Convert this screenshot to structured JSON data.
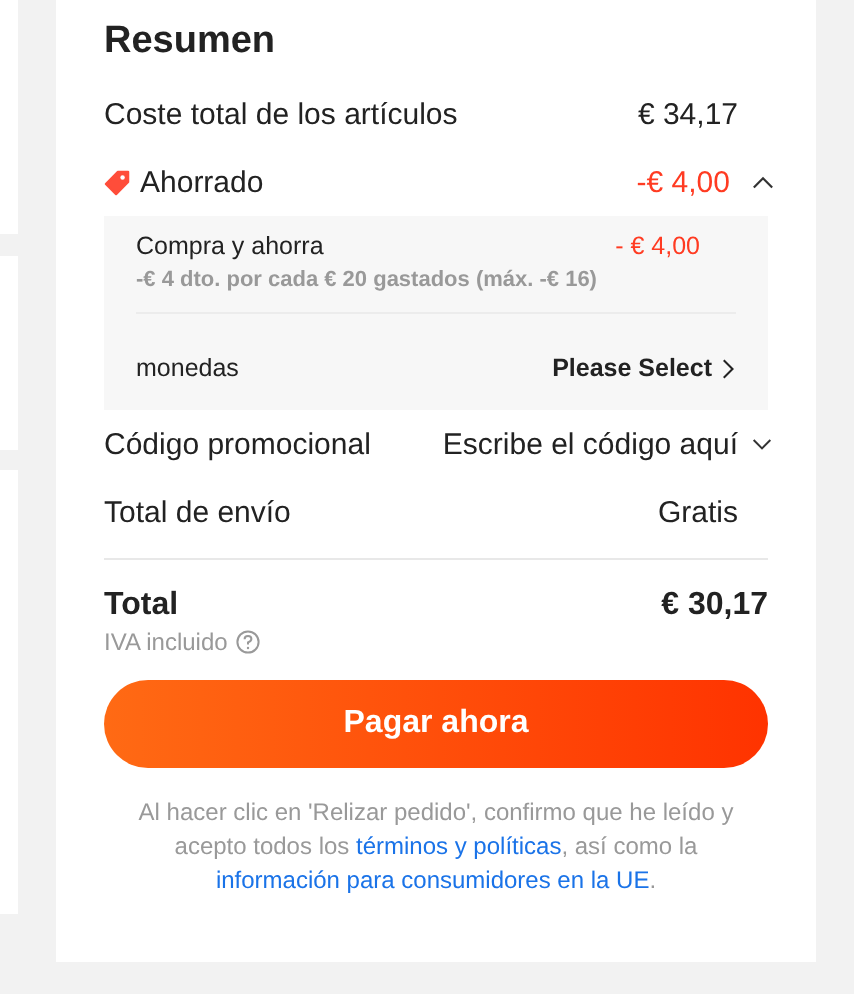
{
  "summary": {
    "title": "Resumen",
    "items_cost": {
      "label": "Coste total de los artículos",
      "value": "€ 34,17"
    },
    "savings": {
      "label": "Ahorrado",
      "value": "-€ 4,00",
      "expanded": true,
      "details": [
        {
          "kind": "discount",
          "label": "Compra y ahorra",
          "value": "- € 4,00",
          "note": "-€ 4 dto. por cada € 20 gastados (máx. -€ 16)"
        },
        {
          "kind": "select",
          "label": "monedas",
          "value": "Please Select"
        }
      ]
    },
    "promo": {
      "label": "Código promocional",
      "placeholder": "Escribe el código aquí"
    },
    "shipping": {
      "label": "Total de envío",
      "value": "Gratis"
    },
    "total": {
      "label": "Total",
      "value": "€ 30,17",
      "note": "IVA incluido"
    },
    "pay_button": "Pagar ahora",
    "legal": [
      {
        "kind": "text",
        "text": "Al hacer clic en 'Relizar pedido', confirmo que he leído y acepto todos los "
      },
      {
        "kind": "link",
        "text": "términos y políticas"
      },
      {
        "kind": "text",
        "text": ", así como la "
      },
      {
        "kind": "link",
        "text": "información para consumidores en la UE"
      },
      {
        "kind": "text",
        "text": "."
      }
    ]
  }
}
